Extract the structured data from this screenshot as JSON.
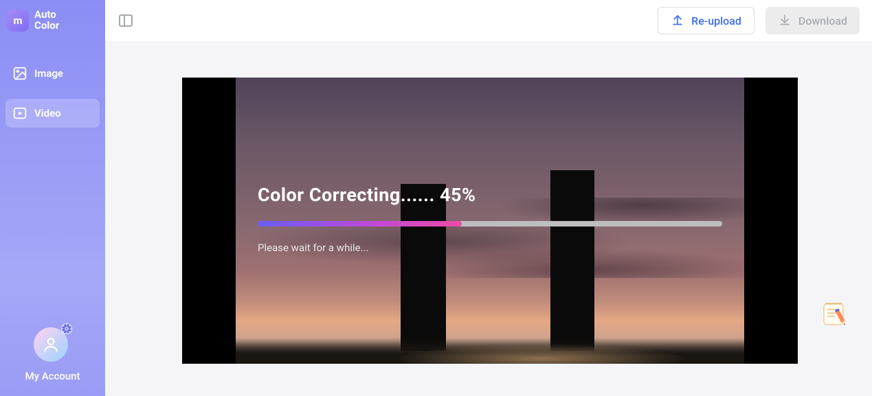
{
  "brand": {
    "logo_letter": "m",
    "title_line1": "Auto",
    "title_line2": "Color"
  },
  "sidebar": {
    "items": [
      {
        "label": "Image",
        "icon": "image-icon",
        "active": false
      },
      {
        "label": "Video",
        "icon": "video-icon",
        "active": true
      }
    ],
    "account_label": "My Account"
  },
  "topbar": {
    "reupload_label": "Re-upload",
    "download_label": "Download"
  },
  "progress": {
    "title_prefix": "Color Correcting......",
    "percent": 45,
    "percent_display": "45%",
    "subtext": "Please wait for a while...",
    "fill_percent": "44%"
  },
  "colors": {
    "sidebar_bg": "#8b8df5",
    "accent_blue": "#3c6df0",
    "progress_start": "#6a5cf5",
    "progress_end": "#ed4aa3"
  }
}
